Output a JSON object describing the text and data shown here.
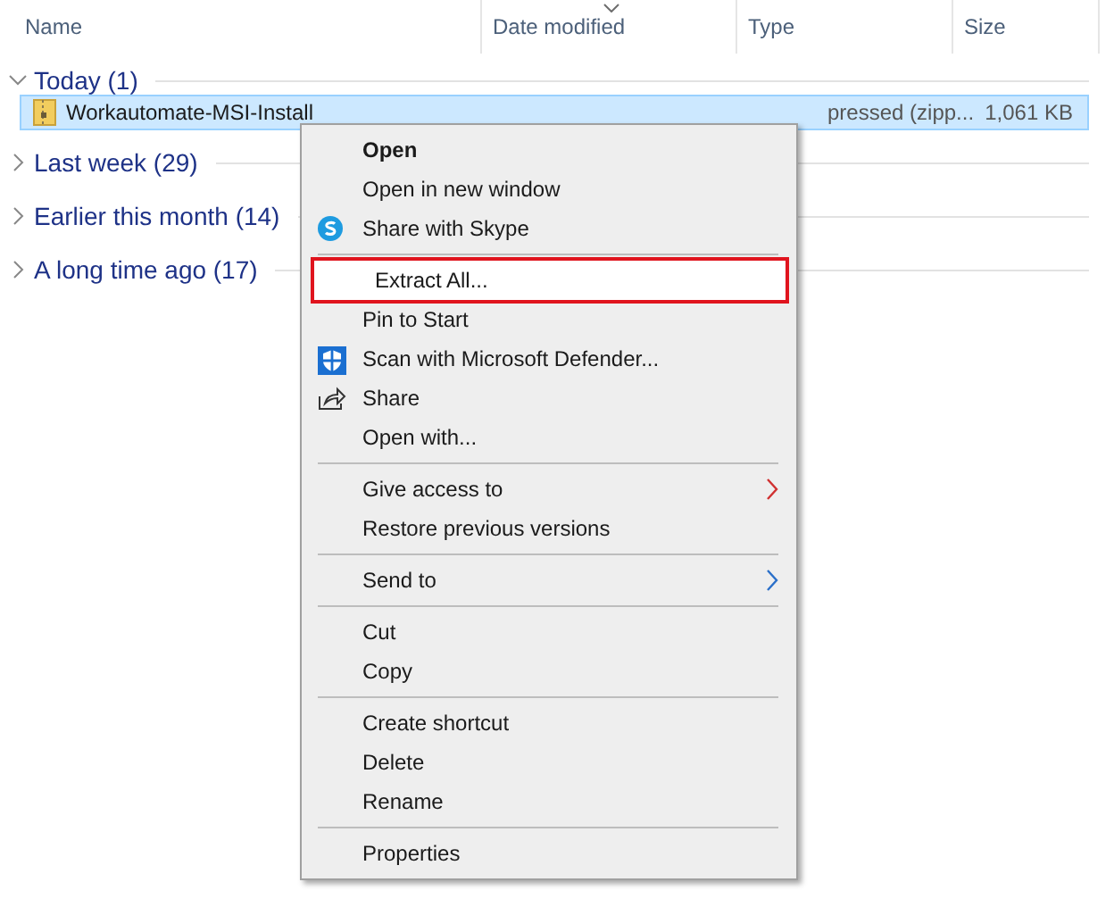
{
  "columns": [
    {
      "label": "Name",
      "sorted": false
    },
    {
      "label": "Date modified",
      "sorted": true
    },
    {
      "label": "Type",
      "sorted": false
    },
    {
      "label": "Size",
      "sorted": false
    }
  ],
  "groups": [
    {
      "label": "Today (1)",
      "expanded": true,
      "files": [
        {
          "name": "Workautomate-MSI-Install",
          "type": "pressed (zipp...",
          "size": "1,061 KB",
          "selected": true
        }
      ]
    },
    {
      "label": "Last week (29)",
      "expanded": false
    },
    {
      "label": "Earlier this month (14)",
      "expanded": false
    },
    {
      "label": "A long time ago (17)",
      "expanded": false
    }
  ],
  "context_menu": {
    "sections": [
      [
        {
          "label": "Open",
          "default": true
        },
        {
          "label": "Open in new window"
        },
        {
          "label": "Share with Skype",
          "kind": "skype"
        }
      ],
      [
        {
          "label": "Extract All...",
          "highlighted": true
        },
        {
          "label": "Pin to Start"
        },
        {
          "label": "Scan with Microsoft Defender...",
          "kind": "defender"
        },
        {
          "label": "Share",
          "kind": "share"
        },
        {
          "label": "Open with..."
        }
      ],
      [
        {
          "label": "Give access to",
          "submenu": true
        },
        {
          "label": "Restore previous versions"
        }
      ],
      [
        {
          "label": "Send to",
          "submenu": true
        }
      ],
      [
        {
          "label": "Cut"
        },
        {
          "label": "Copy"
        }
      ],
      [
        {
          "label": "Create shortcut"
        },
        {
          "label": "Delete"
        },
        {
          "label": "Rename"
        }
      ],
      [
        {
          "label": "Properties"
        }
      ]
    ]
  }
}
